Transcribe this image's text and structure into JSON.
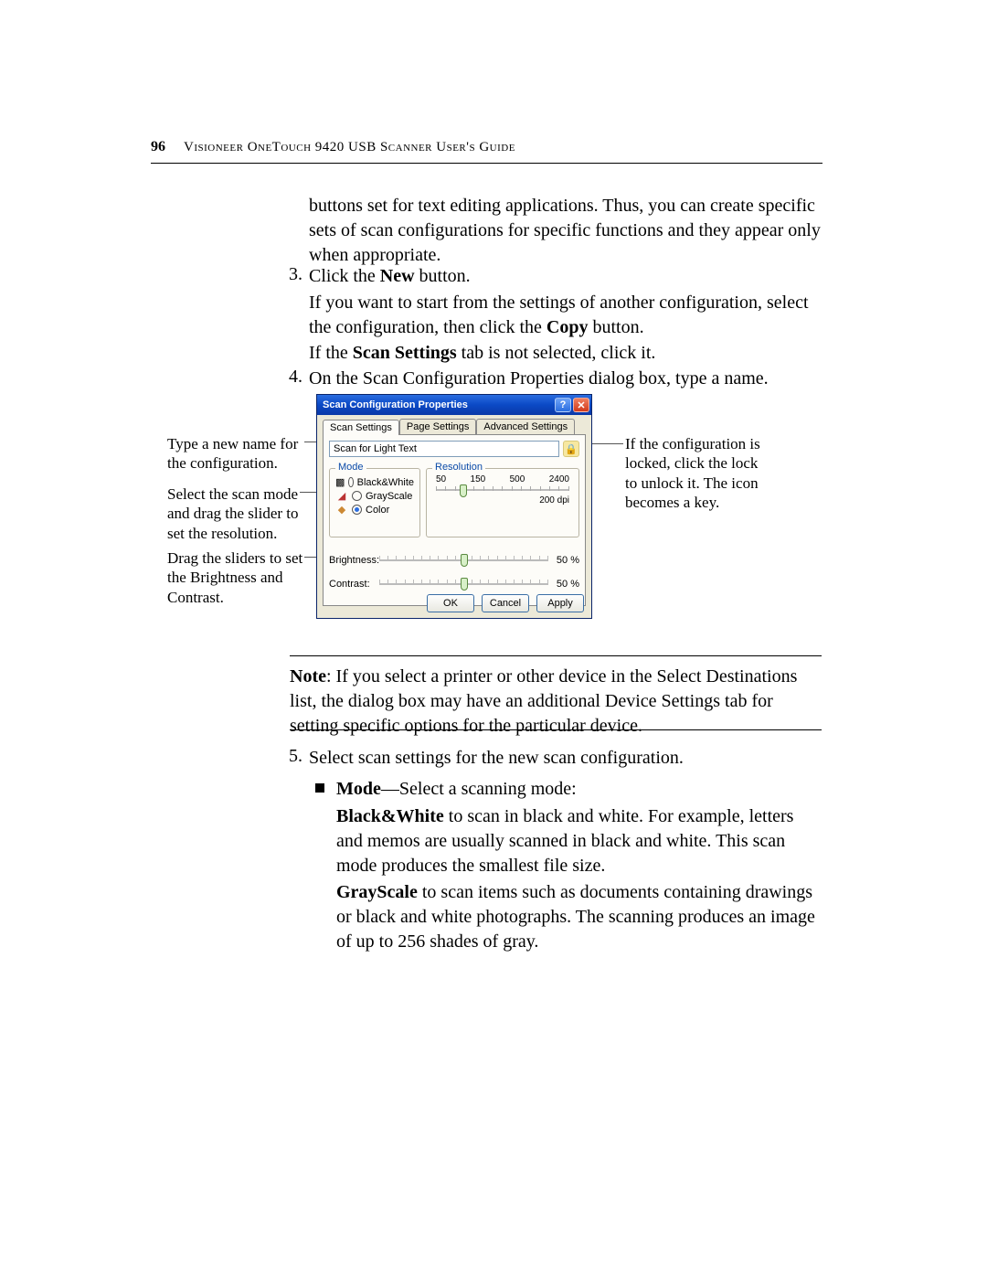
{
  "page_number": "96",
  "header_title": "Visioneer OneTouch 9420 USB Scanner User's Guide",
  "para_intro": "buttons set for text editing applications. Thus, you can create specific sets of scan configurations for specific functions and they appear only when appropriate.",
  "step3_num": "3.",
  "step3_a_pre": "Click the ",
  "step3_a_bold": "New",
  "step3_a_post": " button.",
  "step3_b_pre": "If you want to start from the settings of another configuration, select the configuration, then click the ",
  "step3_b_bold": "Copy",
  "step3_b_post": " button.",
  "step3_c_pre": "If the ",
  "step3_c_bold": "Scan Settings",
  "step3_c_post": " tab is not selected, click it.",
  "step4_num": "4.",
  "step4_text": "On the Scan Configuration Properties dialog box, type a name.",
  "callouts": {
    "name": "Type a new name for the configuration.",
    "mode": "Select the scan mode and drag the slider to set the resolution.",
    "bc": "Drag the sliders to set the Brightness and Contrast.",
    "lock": "If the configuration is locked, click the lock to unlock it. The icon becomes a key."
  },
  "dialog": {
    "title": "Scan Configuration Properties",
    "tabs": [
      "Scan Settings",
      "Page Settings",
      "Advanced Settings"
    ],
    "name_value": "Scan for Light Text",
    "mode_legend": "Mode",
    "resolution_legend": "Resolution",
    "modes": {
      "bw": "Black&White",
      "gray": "GrayScale",
      "color": "Color"
    },
    "res_ticks": [
      "50",
      "150",
      "500",
      "2400"
    ],
    "res_readout": "200 dpi",
    "brightness_label": "Brightness:",
    "contrast_label": "Contrast:",
    "brightness_val": "50 %",
    "contrast_val": "50 %",
    "buttons": {
      "ok": "OK",
      "cancel": "Cancel",
      "apply": "Apply"
    }
  },
  "note_label": "Note",
  "note_text": ":  If you select a printer or other device in the Select Destinations list, the dialog box may have an additional Device Settings tab for setting specific options for the particular device.",
  "step5_num": "5.",
  "step5_text": "Select scan settings for the new scan configuration.",
  "bullet_mode_bold": "Mode",
  "bullet_mode_rest": "—Select a scanning mode:",
  "bw_bold": "Black&White",
  "bw_rest": " to scan in black and white. For example, letters and memos are usually scanned in black and white. This scan mode produces the smallest file size.",
  "gs_bold": "GrayScale",
  "gs_rest": " to scan items such as documents containing drawings or black and white photographs. The scanning produces an image of up to 256 shades of gray."
}
